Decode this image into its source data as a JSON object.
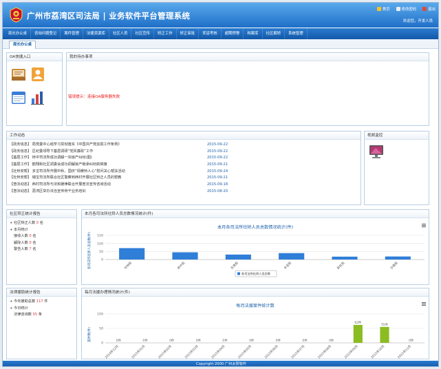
{
  "app": {
    "title": "广州市荔湾区司法局 | 业务软件平台管理系统"
  },
  "top_links": [
    {
      "label": "首页",
      "icon": "home-icon",
      "color": "#f6c12b"
    },
    {
      "label": "修改密码",
      "icon": "key-icon",
      "color": "#e9eef5"
    },
    {
      "label": "退出",
      "icon": "exit-icon",
      "color": "#e04a3a"
    }
  ],
  "welcome": "欢迎您，开发人员",
  "nav": [
    "局长办公桌",
    "咨询问题登记",
    "案件管理",
    "法援资源库",
    "社区人员",
    "社区宣传",
    "矫正工作",
    "矫正审批",
    "奖惩考核",
    "超期预警",
    "档案库",
    "社区解矫",
    "系统管理"
  ],
  "tab": "局长办公桌",
  "oa": {
    "title": "OA快捷入口"
  },
  "todo": {
    "title": "我的待办事项",
    "error": "错误提示：连接OA服务器失败"
  },
  "news": {
    "title": "工作动态",
    "items": [
      {
        "text": "【政务信息】 局党委中心组学习贯彻落实《中国共产党巡视工作条例》",
        "date": "2015-09-22"
      },
      {
        "text": "【政务信息】 区纪委领导下基层调研“党风廉政”工作",
        "date": "2015-09-22"
      },
      {
        "text": "【基层工作】 桥中司法所成功调解一宗房产纠纷(图)",
        "date": "2015-09-22"
      },
      {
        "text": "【基层工作】 鹤翔街社区调委会成功调解房产继承纠纷获锦旗",
        "date": "2015-09-21"
      },
      {
        "text": "【社矫安帮】 多宝司法所开展中秋、国庆“情暖矫人心”慰问关心帮扶活动",
        "date": "2015-09-24"
      },
      {
        "text": "【社矫安帮】 瑞宝司法所联合社区警察到西村开展社区矫正人员的帮教",
        "date": "2015-09-21"
      },
      {
        "text": "【普法动态】 西村司法所与法和援律联合开展普法宣传咨询活动",
        "date": "2015-09-18"
      },
      {
        "text": "【普法动态】 荔湾区举办法治宣传骨干业务培训",
        "date": "2015-08-20"
      }
    ]
  },
  "video": {
    "title": "视频监控"
  },
  "community_stats": {
    "title": "社区矫正统计报告",
    "rows": [
      {
        "label": "社区矫正人数",
        "value": "0",
        "unit": "名"
      },
      {
        "label": "本月统计",
        "value": "",
        "unit": ""
      },
      {
        "label": "接收人数",
        "value": "0",
        "unit": "名"
      },
      {
        "label": "解除人数",
        "value": "0",
        "unit": "名"
      },
      {
        "label": "警告人数",
        "value": "7",
        "unit": "名"
      }
    ]
  },
  "legal_stats": {
    "title": "法律援助统计报告",
    "rows": [
      {
        "label": "今年援助总数",
        "value": "117",
        "unit": "件"
      },
      {
        "label": "今日统计",
        "value": "",
        "unit": ""
      },
      {
        "label": "法律咨询数",
        "value": "55",
        "unit": "条"
      }
    ]
  },
  "chart1_panel": {
    "title": "本月各司法所社矫人员总数情况统计(件)"
  },
  "chart2_panel": {
    "title": "每月法援办理情况统计(件)"
  },
  "chart_data": [
    {
      "type": "bar",
      "title": "本月各司法所社矫人员总数情况统计(件)",
      "ylabel": "各司法所社矫人员总数(件)",
      "categories": [
        "华林街",
        "桥中街",
        "东漖街",
        "多宝街",
        "彩虹街",
        "沙面街"
      ],
      "series": [
        {
          "name": "各司法所社矫人员总数",
          "values": [
            71,
            45,
            31,
            40,
            18,
            19
          ],
          "color": "#2f7ed8"
        }
      ],
      "ylim": [
        0,
        150
      ],
      "yticks": [
        0,
        50,
        100,
        150
      ],
      "legend": "bottom",
      "grid": true
    },
    {
      "type": "bar",
      "title": "每月法援案件统计数",
      "ylabel": "案件数(件)",
      "categories": [
        "2014年12月",
        "2015年01月",
        "2015年02月",
        "2015年03月",
        "2015年04月",
        "2015年05月",
        "2015年06月",
        "2015年07月",
        "2015年08月",
        "2015年09月",
        "2015年10月",
        "2015年11月"
      ],
      "series": [
        {
          "name": "法援案件数",
          "values": [
            0,
            0,
            0,
            0,
            0,
            0,
            0,
            0,
            0,
            62,
            55,
            0
          ],
          "color": "#8bbc21"
        }
      ],
      "value_labels": [
        "0件",
        "0件",
        "0件",
        "0件",
        "0件",
        "0件",
        "0件",
        "0件",
        "0件",
        "62件",
        "55件",
        "0件"
      ],
      "ylim": [
        0,
        100
      ],
      "yticks": [
        0,
        50,
        100
      ],
      "grid": true
    }
  ],
  "footer": "Copyright 2000 广州太赞软件"
}
